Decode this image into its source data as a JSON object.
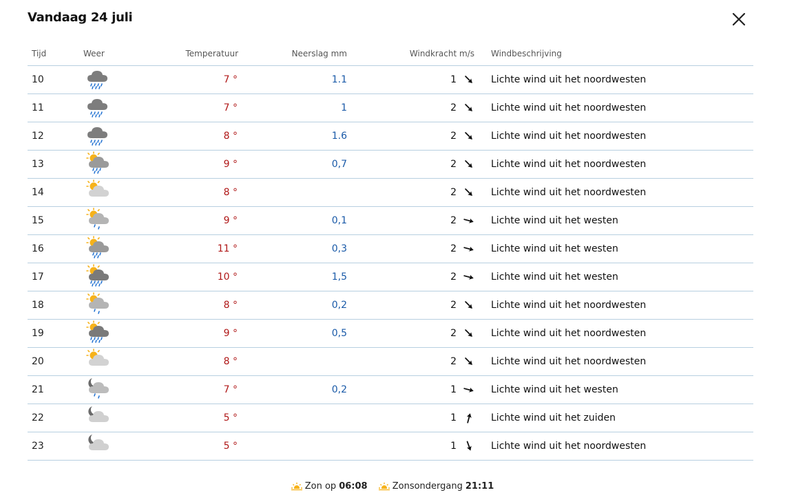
{
  "dialog": {
    "title": "Vandaag 24 juli",
    "close_icon": "close-icon"
  },
  "table": {
    "headers": {
      "time": "Tijd",
      "weather": "Weer",
      "temperature": "Temperatuur",
      "precipitation": "Neerslag mm",
      "wind": "Windkracht m/s",
      "description": "Windbeschrijving"
    },
    "rows": [
      {
        "time": "10",
        "icon": "heavy-rain-cloud-icon",
        "temp": "7 °",
        "precip": "1.1",
        "wind": "1",
        "wind_dir": "arrow-down-right-icon",
        "desc": "Lichte wind uit het noordwesten"
      },
      {
        "time": "11",
        "icon": "heavy-rain-cloud-icon",
        "temp": "7 °",
        "precip": "1",
        "wind": "2",
        "wind_dir": "arrow-down-right-icon",
        "desc": "Lichte wind uit het noordwesten"
      },
      {
        "time": "12",
        "icon": "heavy-rain-cloud-icon",
        "temp": "8 °",
        "precip": "1.6",
        "wind": "2",
        "wind_dir": "arrow-down-right-icon",
        "desc": "Lichte wind uit het noordwesten"
      },
      {
        "time": "13",
        "icon": "sun-cloud-rain-icon",
        "temp": "9 °",
        "precip": "0,7",
        "wind": "2",
        "wind_dir": "arrow-down-right-icon",
        "desc": "Lichte wind uit het noordwesten"
      },
      {
        "time": "14",
        "icon": "partly-cloudy-icon",
        "temp": "8 °",
        "precip": "",
        "wind": "2",
        "wind_dir": "arrow-down-right-icon",
        "desc": "Lichte wind uit het noordwesten"
      },
      {
        "time": "15",
        "icon": "sun-cloud-light-rain-icon",
        "temp": "9 °",
        "precip": "0,1",
        "wind": "2",
        "wind_dir": "arrow-right-icon",
        "desc": "Lichte wind uit het westen"
      },
      {
        "time": "16",
        "icon": "sun-cloud-rain-icon",
        "temp": "11 °",
        "precip": "0,3",
        "wind": "2",
        "wind_dir": "arrow-right-icon",
        "desc": "Lichte wind uit het westen"
      },
      {
        "time": "17",
        "icon": "sun-heavy-rain-cloud-icon",
        "temp": "10 °",
        "precip": "1,5",
        "wind": "2",
        "wind_dir": "arrow-right-icon",
        "desc": "Lichte wind uit het westen"
      },
      {
        "time": "18",
        "icon": "sun-cloud-light-rain-icon",
        "temp": "8 °",
        "precip": "0,2",
        "wind": "2",
        "wind_dir": "arrow-down-right-icon",
        "desc": "Lichte wind uit het noordwesten"
      },
      {
        "time": "19",
        "icon": "sun-heavy-rain-cloud-icon",
        "temp": "9 °",
        "precip": "0,5",
        "wind": "2",
        "wind_dir": "arrow-down-right-icon",
        "desc": "Lichte wind uit het noordwesten"
      },
      {
        "time": "20",
        "icon": "partly-cloudy-icon",
        "temp": "8 °",
        "precip": "",
        "wind": "2",
        "wind_dir": "arrow-down-right-icon",
        "desc": "Lichte wind uit het noordwesten"
      },
      {
        "time": "21",
        "icon": "moon-cloud-light-rain-icon",
        "temp": "7 °",
        "precip": "0,2",
        "wind": "1",
        "wind_dir": "arrow-right-icon",
        "desc": "Lichte wind uit het westen"
      },
      {
        "time": "22",
        "icon": "moon-cloud-icon",
        "temp": "5 °",
        "precip": "",
        "wind": "1",
        "wind_dir": "arrow-up-icon",
        "desc": "Lichte wind uit het zuiden"
      },
      {
        "time": "23",
        "icon": "moon-cloud-icon",
        "temp": "5 °",
        "precip": "",
        "wind": "1",
        "wind_dir": "arrow-down-icon",
        "desc": "Lichte wind uit het noordwesten"
      }
    ]
  },
  "footer": {
    "sunrise_label": "Zon op",
    "sunrise_time": "06:08",
    "sunset_label": "Zonsondergang",
    "sunset_time": "21:11",
    "sunrise_icon": "sunrise-icon",
    "sunset_icon": "sunset-icon"
  },
  "colors": {
    "temperature": "#b01818",
    "precipitation": "#1a5aa8",
    "divider": "#b7cfe0",
    "sun": "#f6b21a",
    "cloud": "#8c8c8c",
    "rain": "#1d6fd1"
  }
}
